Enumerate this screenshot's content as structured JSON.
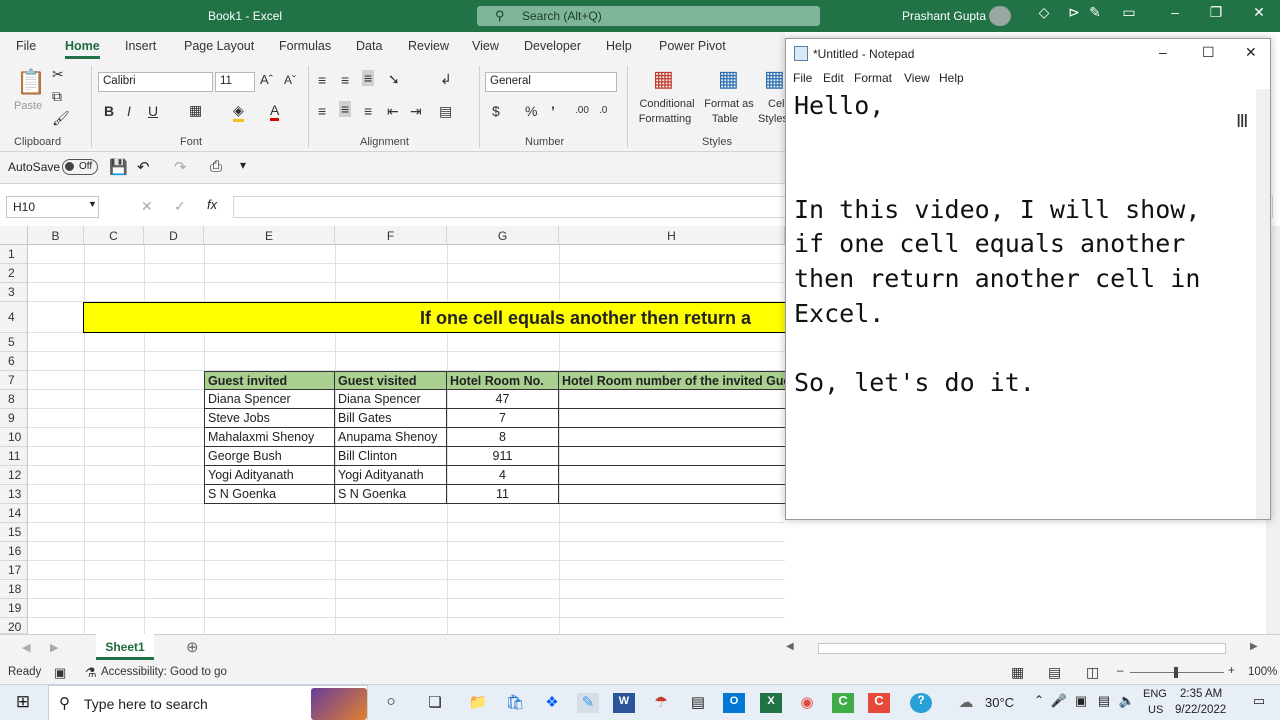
{
  "excel": {
    "window_title": "Book1 - Excel",
    "search_placeholder": "Search (Alt+Q)",
    "user": "Prashant Gupta",
    "tabs": [
      "File",
      "Home",
      "Insert",
      "Page Layout",
      "Formulas",
      "Data",
      "Review",
      "View",
      "Developer",
      "Help",
      "Power Pivot"
    ],
    "active_tab": "Home",
    "ribbon": {
      "paste_label": "Paste",
      "font_name": "Calibri",
      "font_size": "11",
      "number_format": "General",
      "conditional_formatting": [
        "Conditional",
        "Formatting"
      ],
      "format_as_table": [
        "Format as",
        "Table"
      ],
      "cell_styles": [
        "Cell",
        "Styles"
      ],
      "groups": [
        "Clipboard",
        "Font",
        "Alignment",
        "Number",
        "Styles"
      ]
    },
    "qat": {
      "autosave_label": "AutoSave",
      "autosave_state": "Off"
    },
    "name_box": "H10",
    "columns": [
      "B",
      "C",
      "D",
      "E",
      "F",
      "G",
      "H"
    ],
    "rows": [
      "1",
      "2",
      "3",
      "4",
      "5",
      "6",
      "7",
      "8",
      "9",
      "10",
      "11",
      "12",
      "13",
      "14",
      "15",
      "16",
      "17",
      "18",
      "19",
      "20"
    ],
    "banner_text": "If one cell equals another then return a",
    "table": {
      "headers": [
        "Guest invited",
        "Guest visited",
        "Hotel Room No.",
        "Hotel Room number of the invited Gue"
      ],
      "rows": [
        [
          "Diana Spencer",
          "Diana Spencer",
          "47",
          ""
        ],
        [
          "Steve Jobs",
          "Bill Gates",
          "7",
          ""
        ],
        [
          "Mahalaxmi Shenoy",
          "Anupama Shenoy",
          "8",
          ""
        ],
        [
          "George Bush",
          "Bill Clinton",
          "911",
          ""
        ],
        [
          "Yogi Adityanath",
          "Yogi Adityanath",
          "4",
          ""
        ],
        [
          "S N Goenka",
          "S N Goenka",
          "11",
          ""
        ]
      ]
    },
    "sheet_tab": "Sheet1",
    "status": {
      "ready": "Ready",
      "accessibility": "Accessibility: Good to go",
      "zoom": "100%"
    }
  },
  "notepad": {
    "title": "*Untitled - Notepad",
    "menu": [
      "File",
      "Edit",
      "Format",
      "View",
      "Help"
    ],
    "text": "Hello,\n\n\nIn this video, I will show,\nif one cell equals another\nthen return another cell in\nExcel.\n\nSo, let's do it."
  },
  "taskbar": {
    "search_placeholder": "Type here to search",
    "weather": "30°C",
    "lang_line1": "ENG",
    "lang_line2": "US",
    "time": "2:35 AM",
    "date": "9/22/2022"
  },
  "colors": {
    "excel_green": "#217346",
    "header_fill": "#a9d08e",
    "banner_fill": "#ffff00"
  }
}
